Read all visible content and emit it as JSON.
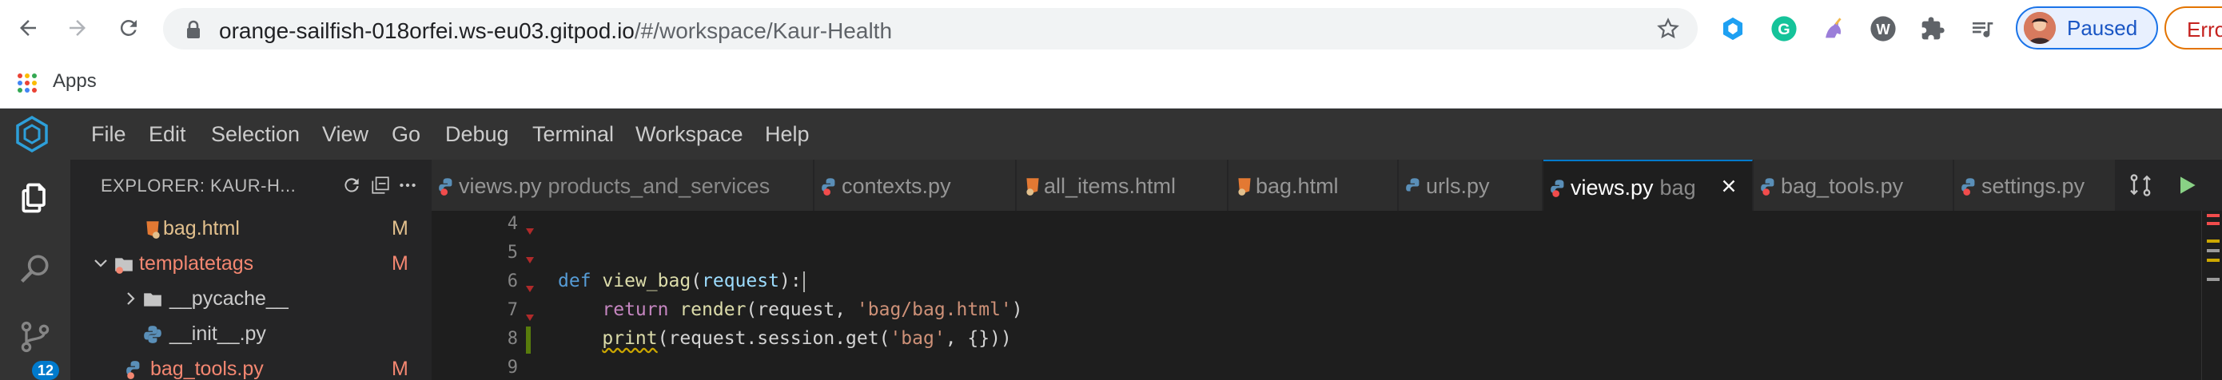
{
  "browser": {
    "url_host": "orange-sailfish-018orfei.ws-eu03.gitpod.io",
    "url_path": "/#/workspace/Kaur-Health",
    "profile_label": "Paused",
    "error_label": "Error"
  },
  "bookmarks": {
    "apps_label": "Apps"
  },
  "menu": {
    "items": [
      "File",
      "Edit",
      "Selection",
      "View",
      "Go",
      "Debug",
      "Terminal",
      "Workspace",
      "Help"
    ]
  },
  "activity": {
    "badge": "12"
  },
  "explorer": {
    "title": "EXPLORER: KAUR-H...",
    "rows": [
      {
        "label": "bag.html",
        "mark": "M",
        "color": "#e2c08d"
      },
      {
        "label": "templatetags",
        "mark": "M",
        "color": "#f48771"
      },
      {
        "label": "__pycache__",
        "mark": "",
        "color": "#cccccc"
      },
      {
        "label": "__init__.py",
        "mark": "",
        "color": "#cccccc"
      },
      {
        "label": "bag_tools.py",
        "mark": "M",
        "color": "#f48771"
      }
    ]
  },
  "tabs": [
    {
      "label": "views.py",
      "desc": "products_and_services",
      "icon": "python-icon"
    },
    {
      "label": "contexts.py",
      "desc": "",
      "icon": "python-icon"
    },
    {
      "label": "all_items.html",
      "desc": "",
      "icon": "html-icon"
    },
    {
      "label": "bag.html",
      "desc": "",
      "icon": "html-icon"
    },
    {
      "label": "urls.py",
      "desc": "",
      "icon": "python-icon"
    },
    {
      "label": "views.py",
      "desc": "bag",
      "icon": "python-icon",
      "active": true
    },
    {
      "label": "bag_tools.py",
      "desc": "",
      "icon": "python-icon"
    },
    {
      "label": "settings.py",
      "desc": "",
      "icon": "python-icon"
    }
  ],
  "editor": {
    "line_numbers": [
      "4",
      "5",
      "6",
      "7",
      "8",
      "9"
    ],
    "code": {
      "l6_kw": "def",
      "l6_fn": "view_bag",
      "l6_open": "(",
      "l6_param": "request",
      "l6_close": "):",
      "l7_indent": "    ",
      "l7_kw": "return",
      "l7_fn": " render",
      "l7_args": "(request, ",
      "l7_str": "'bag/bag.html'",
      "l7_end": ")",
      "l8_indent": "    ",
      "l8_fn": "print",
      "l8_a": "(request.session.get(",
      "l8_str": "'bag'",
      "l8_b": ", {}))"
    }
  },
  "colors": {
    "accent": "#007acc",
    "chrome_profile": "#1a73e8",
    "modified": "#e2c08d",
    "deleted": "#f48771"
  }
}
